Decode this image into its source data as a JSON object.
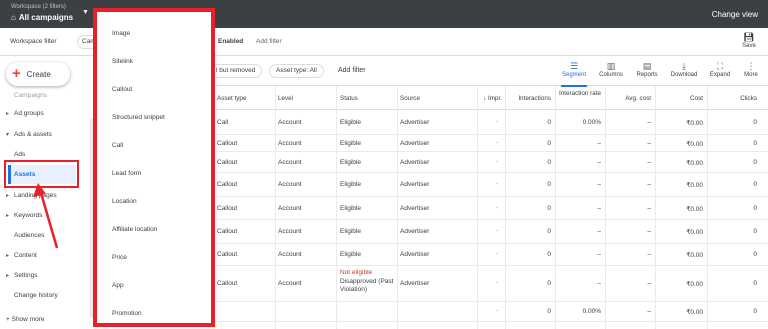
{
  "topbar": {
    "workspace_label": "Workspace (2 filters)",
    "workspace_title": "All campaigns",
    "change_view": "Change view"
  },
  "filterbar": {
    "label": "Workspace filter",
    "chip": "Campa",
    "enabled": "Enabled",
    "add_filter": "Add filter",
    "save": "Save"
  },
  "sidebar": {
    "create": "Create",
    "items": [
      {
        "label": "Campaigns",
        "arrow": ""
      },
      {
        "label": "Ad groups",
        "arrow": "▸"
      },
      {
        "label": "Ads & assets",
        "arrow": "▾"
      },
      {
        "label": "Ads",
        "arrow": ""
      },
      {
        "label": "Assets",
        "arrow": ""
      },
      {
        "label": "Landing pages",
        "arrow": "▸"
      },
      {
        "label": "Keywords",
        "arrow": "▸"
      },
      {
        "label": "Audiences",
        "arrow": ""
      },
      {
        "label": "Content",
        "arrow": "▸"
      },
      {
        "label": "Settings",
        "arrow": "▸"
      },
      {
        "label": "Change history",
        "arrow": ""
      }
    ],
    "show_more": "Show more"
  },
  "dropdown": {
    "items": [
      "Image",
      "Sitelink",
      "Callout",
      "Structured snippet",
      "Call",
      "Lead form",
      "Location",
      "Affiliate location",
      "Price",
      "App",
      "Promotion"
    ]
  },
  "toolbar": {
    "chip_removed": "l but removed",
    "chip_type": "Asset type: All",
    "add_filter": "Add filter",
    "tools": [
      {
        "label": "Segment",
        "icon": "segment-icon",
        "glyph": "☰"
      },
      {
        "label": "Columns",
        "icon": "columns-icon",
        "glyph": "▥"
      },
      {
        "label": "Reports",
        "icon": "reports-icon",
        "glyph": "▤"
      },
      {
        "label": "Download",
        "icon": "download-icon",
        "glyph": "⤓"
      },
      {
        "label": "Expand",
        "icon": "expand-icon",
        "glyph": "⛶"
      },
      {
        "label": "More",
        "icon": "more-icon",
        "glyph": "⋮"
      }
    ]
  },
  "table": {
    "headers": [
      "Asset type",
      "Level",
      "Status",
      "Source",
      "↓ Impr.",
      "Interactions",
      "Interaction rate",
      "Avg. cost",
      "Cost",
      "Clicks"
    ],
    "rows": [
      [
        "Call",
        "Account",
        "Eligible",
        "Advertiser",
        "",
        "0",
        "0.00%",
        "–",
        "₹0.00",
        "0"
      ],
      [
        "Callout",
        "Account",
        "Eligible",
        "Advertiser",
        "",
        "0",
        "–",
        "–",
        "₹0.00",
        "0"
      ],
      [
        "Callout",
        "Account",
        "Eligible",
        "Advertiser",
        "",
        "0",
        "–",
        "–",
        "₹0.00",
        "0"
      ],
      [
        "Callout",
        "Account",
        "Eligible",
        "Advertiser",
        "",
        "0",
        "–",
        "–",
        "₹0.00",
        "0"
      ],
      [
        "Callout",
        "Account",
        "Eligible",
        "Advertiser",
        "",
        "0",
        "–",
        "–",
        "₹0.00",
        "0"
      ],
      [
        "Callout",
        "Account",
        "Eligible",
        "Advertiser",
        "",
        "0",
        "–",
        "–",
        "₹0.00",
        "0"
      ],
      [
        "Callout",
        "Account",
        "Eligible",
        "Advertiser",
        "",
        "0",
        "–",
        "–",
        "₹0.00",
        "0"
      ],
      [
        "Callout",
        "Account",
        "Not eligible",
        "Advertiser",
        "",
        "0",
        "–",
        "–",
        "₹0.00",
        "0"
      ],
      [
        "",
        "",
        "",
        "",
        "",
        "0",
        "0.00%",
        "–",
        "₹0.00",
        "0"
      ]
    ],
    "status_detail": "Disapproved (Past Violation)"
  },
  "colors": {
    "highlight": "#e8202a",
    "accent": "#1a73e8",
    "not_eligible": "#d93025"
  }
}
